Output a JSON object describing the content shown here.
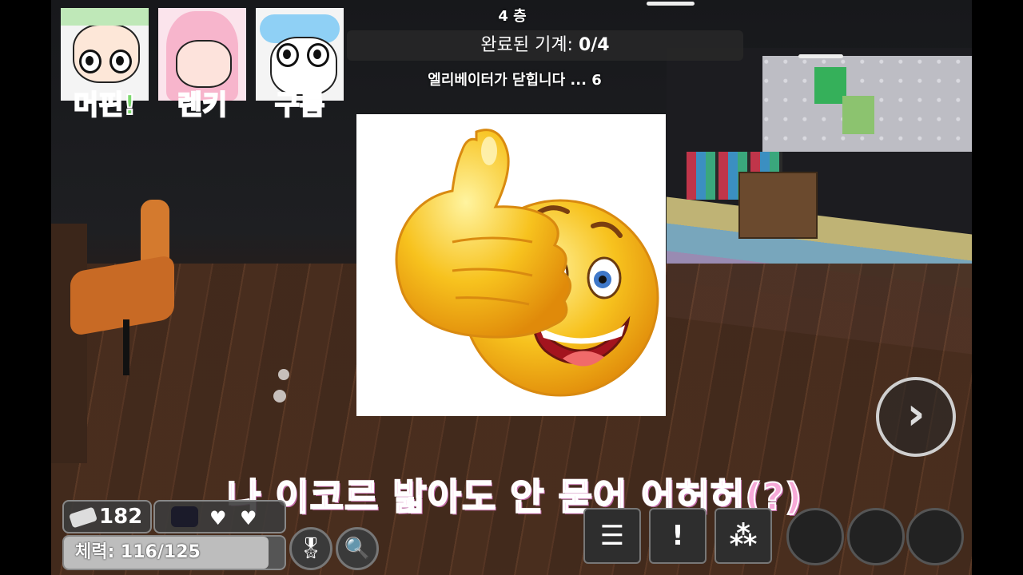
{
  "hud_top": {
    "floor": "4 층",
    "stores_label": "완료된 기계: ",
    "stores_value": "0/4",
    "elevator_notice": "엘리베이터가 닫힙니다 ... 6"
  },
  "portraits": [
    {
      "name": "머핀!",
      "color": "#7dd86e"
    },
    {
      "name": "렌키",
      "color": "#f59bd0"
    },
    {
      "name": "구름",
      "color": "#69b4ef"
    }
  ],
  "subtitle": "나 이코르 밟아도 안 묻어 어허허(?)",
  "stats": {
    "ichor": "182",
    "health_label": "체력: 116/125",
    "health_fraction": 0.928,
    "lives_remaining": 2
  },
  "buttons": {
    "next_symbol": "›",
    "ping_symbol": "!",
    "emote_symbol": "⁂",
    "menu_symbol": "☰"
  },
  "colors": {
    "subtitle": "#f7a9d8",
    "sticker_face": "#f5b81c"
  }
}
